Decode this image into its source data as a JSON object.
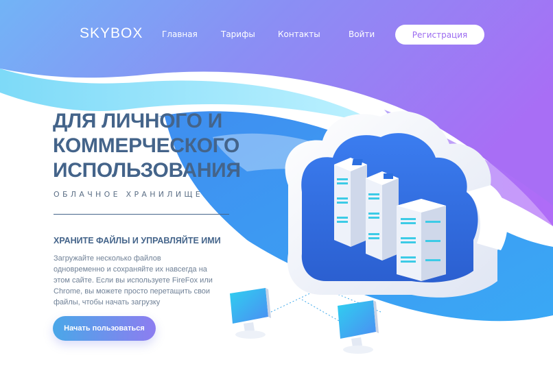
{
  "header": {
    "logo": "SKYBOX",
    "nav": [
      {
        "label": "Главная"
      },
      {
        "label": "Тарифы"
      },
      {
        "label": "Контакты"
      },
      {
        "label": "Войти"
      }
    ],
    "register_label": "Регистрация"
  },
  "hero": {
    "title_lines": [
      "ДЛЯ ЛИЧНОГО И",
      "КОММЕРЧЕСКОГО",
      "ИСПОЛЬЗОВАНИЯ"
    ],
    "subtitle": "ОБЛАЧНОЕ ХРАНИЛИЩЕ",
    "section_heading": "ХРАНИТЕ ФАЙЛЫ И УПРАВЛЯЙТЕ ИМИ",
    "description_lines": [
      "Загружайте несколько файлов",
      "одновременно и сохраняйте их навсегда на",
      "этом сайте. Если вы используете FireFox или",
      "Chrome, вы можете просто перетащить свои",
      "файлы, чтобы начать загрузку"
    ],
    "cta_label": "Начать пользоваться"
  },
  "illustration": {
    "icons": [
      "cloud-icon",
      "server-rack-icon",
      "monitor-icon"
    ]
  },
  "colors": {
    "purple": "#9b6bf0",
    "blue": "#4aa7e8",
    "title": "#44648a",
    "text": "#6f8096"
  }
}
